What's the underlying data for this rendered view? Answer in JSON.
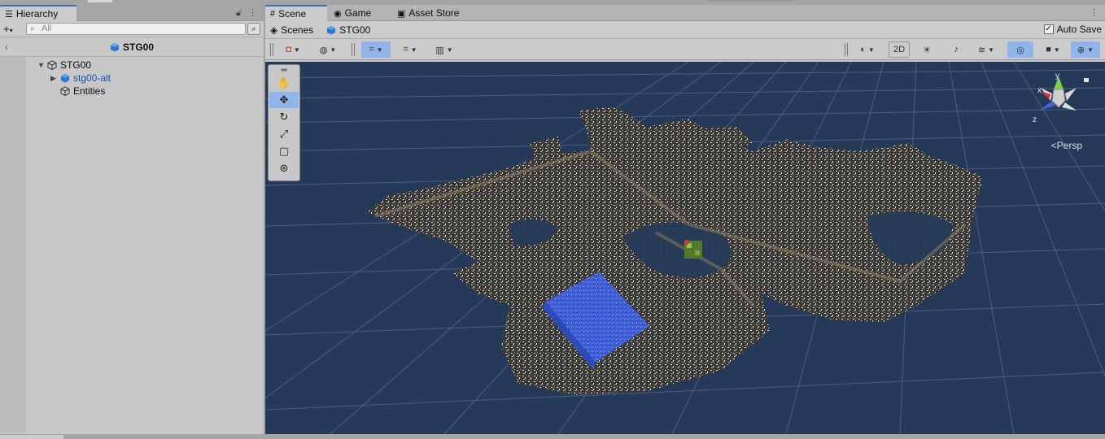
{
  "hierarchy": {
    "tab_label": "Hierarchy",
    "search_placeholder": "All",
    "scene_name": "STG00",
    "tree": [
      {
        "label": "STG00"
      },
      {
        "label": "stg00-alt"
      },
      {
        "label": "Entities"
      }
    ]
  },
  "scene_panel": {
    "tabs": [
      {
        "label": "Scene"
      },
      {
        "label": "Game"
      },
      {
        "label": "Asset Store"
      }
    ],
    "breadcrumb": {
      "root": "Scenes",
      "current": "STG00"
    },
    "auto_save_label": "Auto Save",
    "auto_save_checked": true,
    "toolbar": {
      "mode_2d": "2D"
    },
    "gizmo": {
      "persp_label": "<Persp",
      "axis_x": "x",
      "axis_y": "y",
      "axis_z": "z"
    }
  },
  "colors": {
    "accent": "#3a72c3",
    "toggle_on": "#8fb5eb",
    "viewport_bg": "#243a58",
    "prefab_text": "#1a4fa8"
  }
}
